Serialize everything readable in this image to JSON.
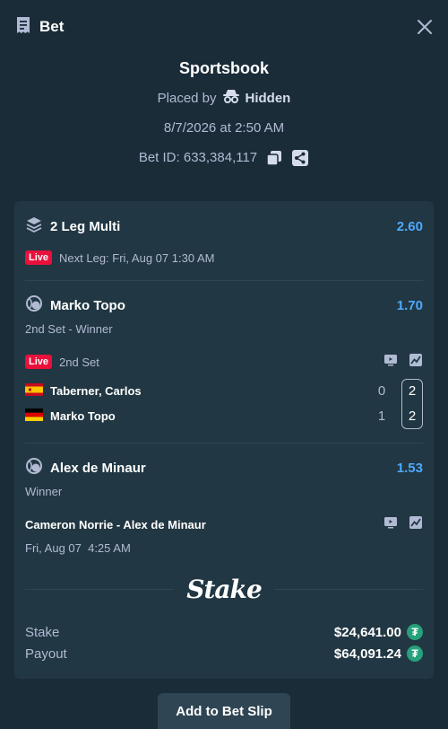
{
  "header": {
    "title": "Bet"
  },
  "meta": {
    "book": "Sportsbook",
    "placed_by_label": "Placed by",
    "placed_by_name": "Hidden",
    "datetime": "8/7/2026 at 2:50 AM",
    "bet_id": "Bet ID: 633,384,117"
  },
  "multi": {
    "title": "2 Leg Multi",
    "odds": "2.60",
    "live_label": "Live",
    "next_leg": "Next Leg: Fri, Aug 07 1:30 AM"
  },
  "legs": [
    {
      "selection": "Marko Topo",
      "odds": "1.70",
      "market": "2nd Set - Winner",
      "live_label": "Live",
      "period": "2nd Set",
      "teams": [
        {
          "name": "Taberner, Carlos",
          "flag": "spain",
          "prev": "0",
          "current": "2"
        },
        {
          "name": "Marko Topo",
          "flag": "germany",
          "prev": "1",
          "current": "2"
        }
      ]
    },
    {
      "selection": "Alex de Minaur",
      "odds": "1.53",
      "market": "Winner",
      "event": "Cameron Norrie - Alex de Minaur",
      "time": "Fri, Aug 07  4:25 AM"
    }
  ],
  "brand": {
    "logo_text": "Stake"
  },
  "totals": {
    "stake_label": "Stake",
    "stake_value": "$24,641.00",
    "payout_label": "Payout",
    "payout_value": "$64,091.24",
    "currency_icon": "tether-icon"
  },
  "actions": {
    "add_to_slip": "Add to Bet Slip"
  },
  "colors": {
    "background": "#1a2c38",
    "card": "#213743",
    "odds": "#4fa9ff",
    "live": "#e9113c",
    "muted_text": "#b1bad3",
    "tether": "#26a17b"
  }
}
